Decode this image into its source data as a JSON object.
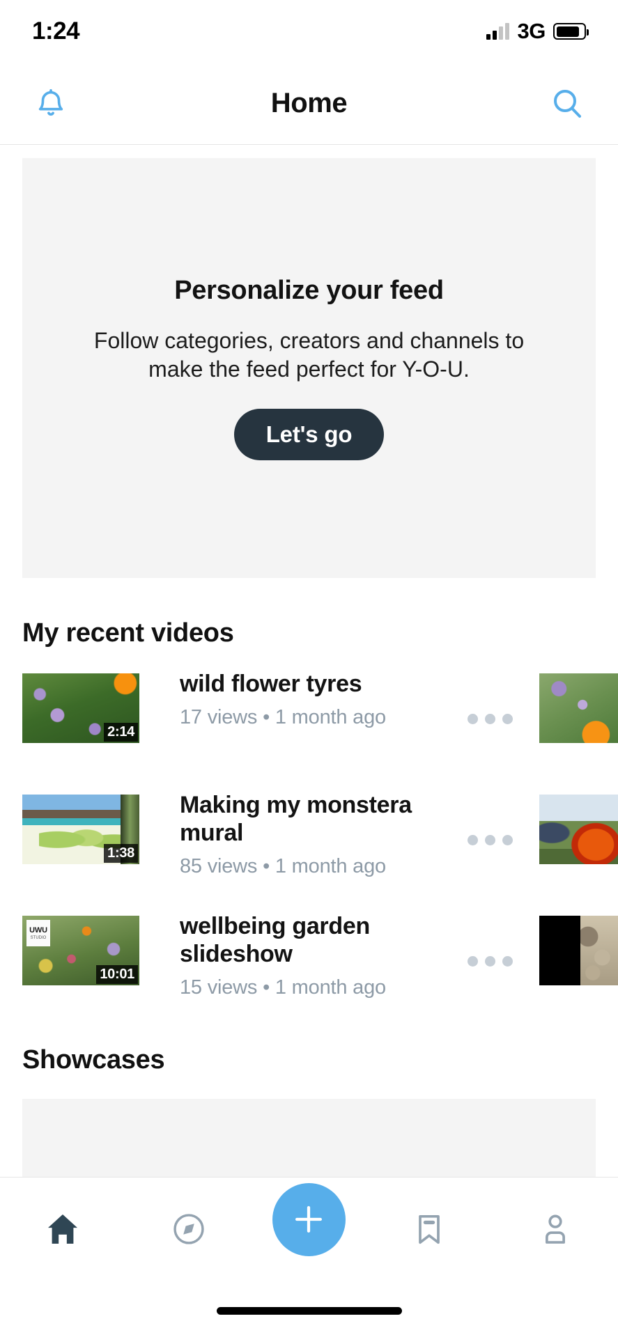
{
  "status_bar": {
    "time": "1:24",
    "network": "3G",
    "signal_icon": "cellular-signal-icon",
    "battery_icon": "battery-icon"
  },
  "header": {
    "title": "Home",
    "notifications_icon": "bell-icon",
    "search_icon": "search-icon",
    "accent_color": "#57aeea"
  },
  "promo": {
    "title": "Personalize your feed",
    "subtitle": "Follow categories, creators and channels to make the feed perfect for Y-O-U.",
    "button_label": "Let's go",
    "button_color": "#26343f"
  },
  "sections": {
    "recent_videos_title": "My recent videos",
    "showcases_title": "Showcases"
  },
  "videos": [
    {
      "title": "wild flower tyres",
      "meta": "17 views • 1 month ago",
      "views": "17 views",
      "age": "1 month ago",
      "duration": "2:14",
      "more_icon": "more-options-icon"
    },
    {
      "title": "Making my monstera mural",
      "meta": "85 views • 1 month ago",
      "views": "85 views",
      "age": "1 month ago",
      "duration": "1:38",
      "more_icon": "more-options-icon"
    },
    {
      "title": "wellbeing garden slideshow",
      "meta": "15 views • 1 month ago",
      "views": "15 views",
      "age": "1 month ago",
      "duration": "10:01",
      "badge_text": "UWU",
      "badge_sub": "STUDIO",
      "more_icon": "more-options-icon"
    }
  ],
  "tabbar": {
    "items": [
      {
        "name": "home",
        "icon": "home-icon",
        "active": true
      },
      {
        "name": "explore",
        "icon": "compass-icon",
        "active": false
      },
      {
        "name": "create",
        "icon": "plus-icon",
        "active": false
      },
      {
        "name": "library",
        "icon": "bookmark-icon",
        "active": false
      },
      {
        "name": "profile",
        "icon": "person-icon",
        "active": false
      }
    ],
    "fab_color": "#57aeea",
    "active_color": "#2f4654",
    "inactive_color": "#94a3b0"
  }
}
